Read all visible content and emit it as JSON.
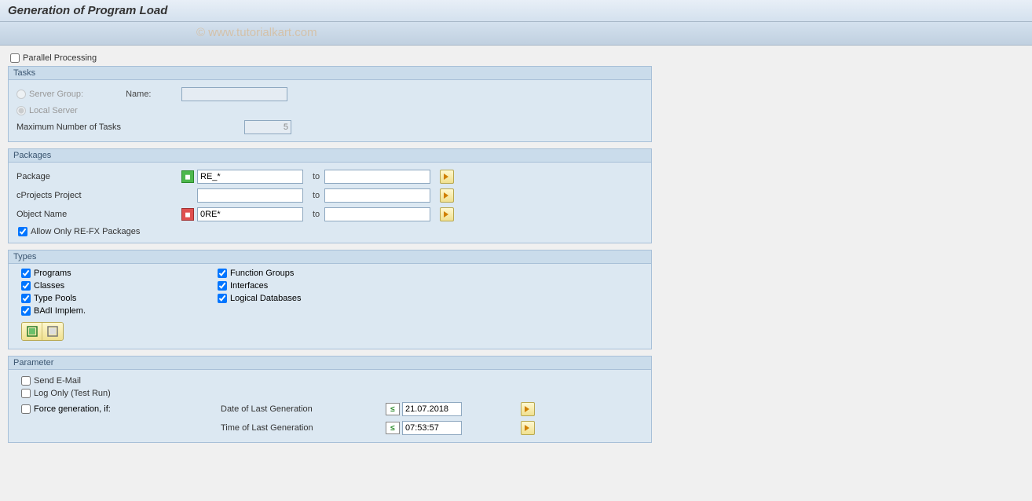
{
  "header": {
    "title": "Generation of Program Load"
  },
  "watermark": "© www.tutorialkart.com",
  "parallel": {
    "label": "Parallel Processing",
    "tasks_title": "Tasks",
    "server_group_label": "Server Group:",
    "name_label": "Name:",
    "local_server_label": "Local Server",
    "max_tasks_label": "Maximum Number of Tasks",
    "max_tasks_value": "5"
  },
  "packages": {
    "title": "Packages",
    "rows": [
      {
        "label": "Package",
        "from": "RE_*",
        "to": "",
        "icon": "green"
      },
      {
        "label": "cProjects Project",
        "from": "",
        "to": "",
        "icon": "none"
      },
      {
        "label": "Object Name",
        "from": "0RE*",
        "to": "",
        "icon": "red"
      }
    ],
    "to_label": "to",
    "allow_label": "Allow Only RE-FX Packages"
  },
  "types": {
    "title": "Types",
    "items_col1": [
      "Programs",
      "Classes",
      "Type Pools",
      "BAdI Implem."
    ],
    "items_col2": [
      "Function Groups",
      "Interfaces",
      "Logical Databases"
    ]
  },
  "parameter": {
    "title": "Parameter",
    "send_email": "Send E-Mail",
    "log_only": "Log Only (Test Run)",
    "force_gen": "Force generation, if:",
    "date_label": "Date of Last Generation",
    "date_value": "21.07.2018",
    "time_label": "Time of Last Generation",
    "time_value": "07:53:57",
    "le_symbol": "≤"
  }
}
